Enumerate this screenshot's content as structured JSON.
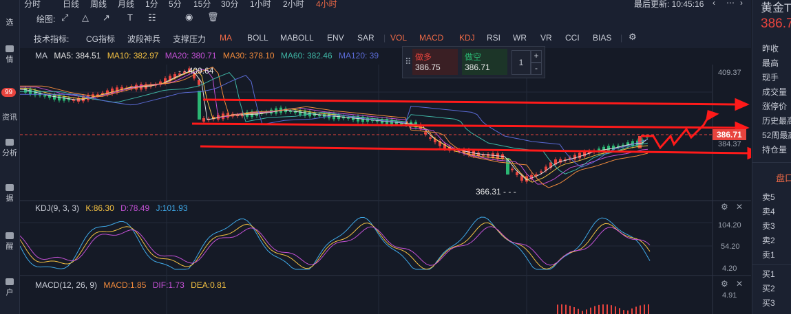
{
  "sidebar": {
    "items": [
      "选",
      "情",
      "资讯",
      "分析",
      "据",
      "醒",
      "户"
    ],
    "badge": "99"
  },
  "topbar": {
    "periods": [
      "分时",
      "日线",
      "周线",
      "月线",
      "1分",
      "5分",
      "15分",
      "30分",
      "1小时",
      "2小时",
      "4小时"
    ],
    "active_period": "4小时",
    "last_update": "最后更新: 10:45:16"
  },
  "drawbar": {
    "label": "绘图:"
  },
  "indicators": {
    "label": "技术指标:",
    "items": [
      "CG指标",
      "波段神兵",
      "支撑压力",
      "MA",
      "BOLL",
      "MABOLL",
      "ENV",
      "SAR",
      "VOL",
      "MACD",
      "KDJ",
      "RSI",
      "WR",
      "VR",
      "CCI",
      "BIAS"
    ],
    "active": [
      "MA",
      "VOL",
      "MACD",
      "KDJ"
    ]
  },
  "ma_legend": {
    "name": "MA",
    "ma5": "MA5: 384.51",
    "ma10": "MA10: 382.97",
    "ma20": "MA20: 380.71",
    "ma30": "MA30: 378.10",
    "ma60": "MA60: 382.46",
    "ma120": "MA120: 39"
  },
  "order_box": {
    "buy_label": "做多",
    "buy_price": "386.75",
    "sell_label": "做空",
    "sell_price": "386.71",
    "qty": "1",
    "plus": "+",
    "minus": "-"
  },
  "price_axis": {
    "top": "409.37",
    "current": "386.71",
    "lower": "384.37",
    "high_mark": "409.64",
    "low_mark": "366.31"
  },
  "kdj_legend": {
    "name": "KDJ(9, 3, 3)",
    "k": "K:86.30",
    "d": "D:78.49",
    "j": "J:101.93"
  },
  "kdj_axis": [
    "104.20",
    "54.20",
    "4.20"
  ],
  "macd_legend": {
    "name": "MACD(12, 26, 9)",
    "macd": "MACD:1.85",
    "dif": "DIF:1.73",
    "dea": "DEA:0.81"
  },
  "macd_axis": [
    "4.91"
  ],
  "right_panel": {
    "title": "黄金T",
    "price": "386.7",
    "fields": [
      "昨收",
      "最高",
      "现手",
      "成交量",
      "涨停价",
      "历史最高",
      "52周最高",
      "持仓量"
    ],
    "section": "盘口",
    "sells": [
      "卖5",
      "卖4",
      "卖3",
      "卖2",
      "卖1"
    ],
    "buys": [
      "买1",
      "买2",
      "买3"
    ]
  },
  "colors": {
    "up": "#e8443e",
    "down": "#2bb673",
    "ma5": "#e0e0e0",
    "ma10": "#f5c242",
    "ma20": "#c451d6",
    "ma30": "#f08a3c",
    "ma60": "#3fb5a5",
    "ma120": "#5b6bd6",
    "accent": "#f06a46"
  }
}
